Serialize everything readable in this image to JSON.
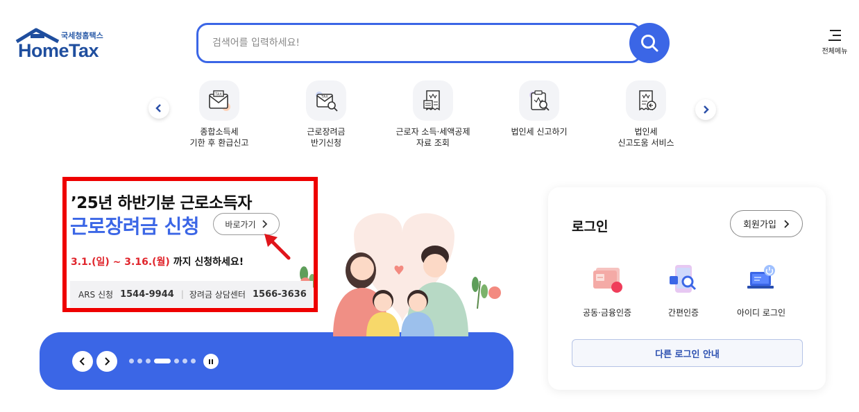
{
  "header": {
    "logo_sub": "국세청홈택스",
    "logo_main": "HomeTax",
    "search_placeholder": "검색어를 입력하세요!",
    "menu_label": "전체메뉴"
  },
  "quick_services": [
    {
      "line1": "종합소득세",
      "line2": "기한 후 환급신고",
      "icon": "tax-envelope-icon"
    },
    {
      "line1": "근로장려금",
      "line2": "반기신청",
      "icon": "tax-search-icon"
    },
    {
      "line1": "근로자 소득·세액공제",
      "line2": "자료 조회",
      "icon": "receipt-list-icon"
    },
    {
      "line1": "법인세 신고하기",
      "line2": "",
      "icon": "clipboard-search-icon"
    },
    {
      "line1": "법인세",
      "line2": "신고도움 서비스",
      "icon": "receipt-help-icon"
    }
  ],
  "banner": {
    "title1": "’25년 하반기분 근로소득자",
    "title2": "근로장려금 신청",
    "goto_label": "바로가기",
    "date_start": "3.1.(일)",
    "date_tilde": " ~ ",
    "date_end": "3.16.(월)",
    "date_suffix": " 까지 신청하세요!",
    "ars_label": "ARS 신청",
    "ars_number": "1544-9944",
    "center_label": "장려금 상담센터",
    "center_number": "1566-3636",
    "slide_count": 7,
    "active_slide": 4
  },
  "login": {
    "title": "로그인",
    "join_label": "회원가입",
    "options": [
      {
        "label": "공동·금융인증",
        "icon": "certificate-card-icon"
      },
      {
        "label": "간편인증",
        "icon": "phone-search-icon"
      },
      {
        "label": "아이디 로그인",
        "icon": "laptop-power-icon"
      }
    ],
    "other_login_label": "다른 로그인 안내"
  },
  "colors": {
    "primary_blue": "#3b66e6",
    "logo_blue": "#1f4e9e",
    "highlight_red": "#ee0000",
    "date_red": "#e0252c"
  }
}
